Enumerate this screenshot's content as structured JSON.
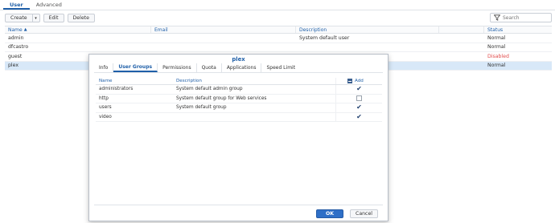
{
  "top_tabs": [
    "User",
    "Advanced"
  ],
  "toolbar": {
    "create": "Create",
    "edit": "Edit",
    "delete": "Delete"
  },
  "filter": {
    "placeholder": "Search"
  },
  "table": {
    "headers": {
      "name": "Name",
      "email": "Email",
      "description": "Description",
      "status": "Status"
    },
    "rows": [
      {
        "name": "admin",
        "email": "",
        "description": "System default user",
        "status": "Normal"
      },
      {
        "name": "dfcastro",
        "email": "",
        "description": "",
        "status": "Normal"
      },
      {
        "name": "guest",
        "email": "",
        "description": "",
        "status": "Disabled"
      },
      {
        "name": "plex",
        "email": "",
        "description": "",
        "status": "Normal"
      }
    ]
  },
  "modal": {
    "title": "plex",
    "tabs": [
      "Info",
      "User Groups",
      "Permissions",
      "Quota",
      "Applications",
      "Speed Limit"
    ],
    "grid_headers": {
      "name": "Name",
      "description": "Description",
      "add": "Add"
    },
    "groups": [
      {
        "name": "administrators",
        "description": "System default admin group",
        "add": true
      },
      {
        "name": "http",
        "description": "System default group for Web services",
        "add": false
      },
      {
        "name": "users",
        "description": "System default group",
        "add": true
      },
      {
        "name": "video",
        "description": "",
        "add": true
      }
    ],
    "ok": "OK",
    "cancel": "Cancel"
  },
  "colors": {
    "accent": "#1f5fa8",
    "selected_row": "#d8e8f8",
    "disabled": "#e14b4b",
    "primary_button": "#2e6fc7"
  }
}
